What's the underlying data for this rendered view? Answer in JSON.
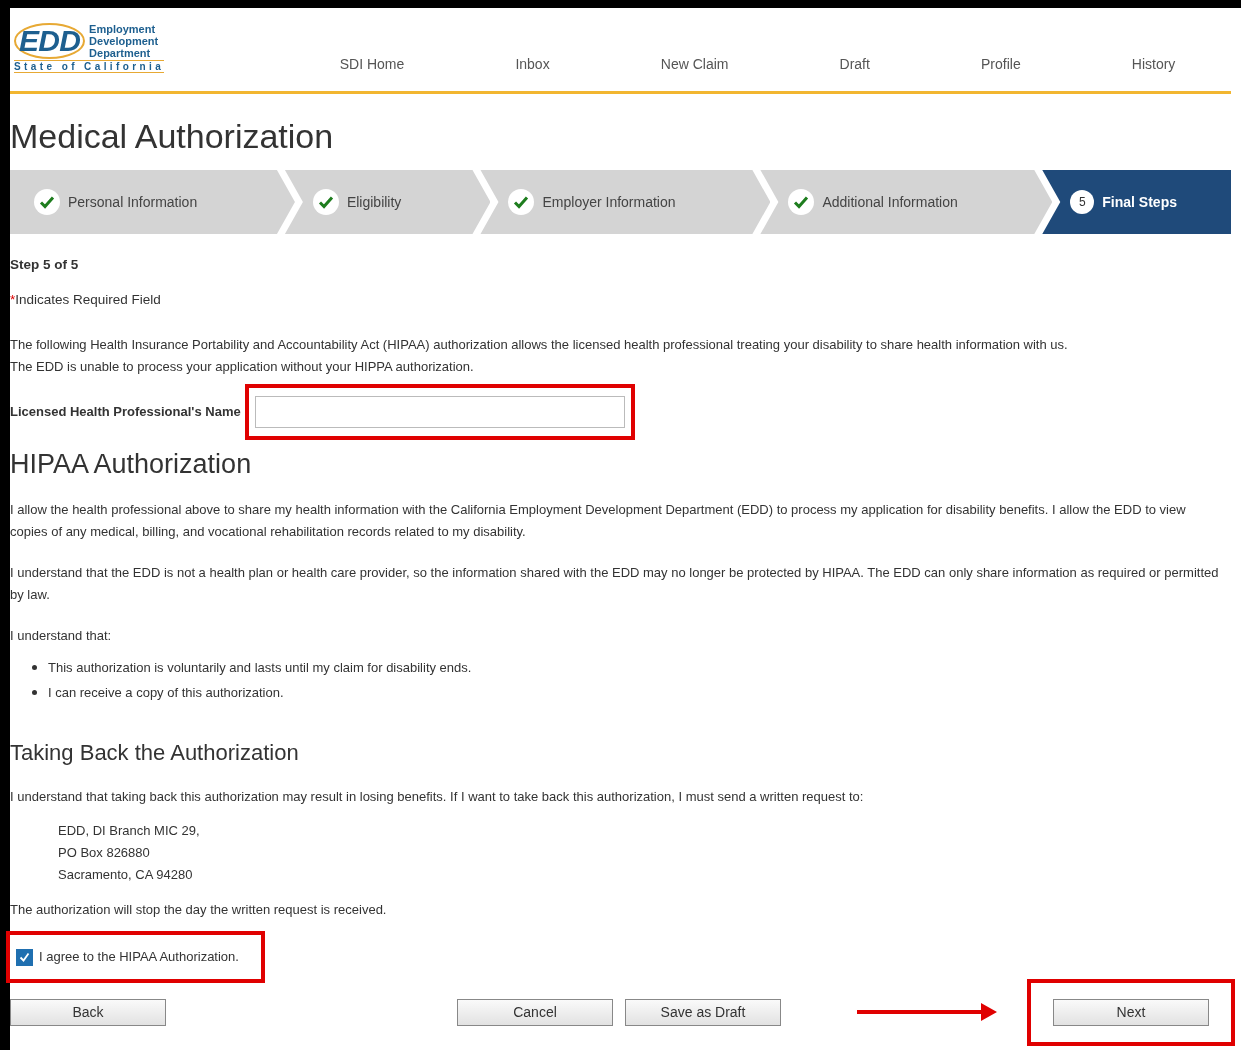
{
  "logo": {
    "acronym": "EDD",
    "name_lines": [
      "Employment",
      "Development",
      "Department"
    ],
    "state": "State of California"
  },
  "nav": [
    {
      "label": "SDI Home"
    },
    {
      "label": "Inbox"
    },
    {
      "label": "New Claim"
    },
    {
      "label": "Draft"
    },
    {
      "label": "Profile"
    },
    {
      "label": "History"
    }
  ],
  "page_title": "Medical Authorization",
  "steps": [
    {
      "label": "Personal Information",
      "kind": "complete"
    },
    {
      "label": "Eligibility",
      "kind": "complete"
    },
    {
      "label": "Employer Information",
      "kind": "complete"
    },
    {
      "label": "Additional Information",
      "kind": "complete"
    },
    {
      "label": "Final Steps",
      "kind": "current",
      "number": "5"
    }
  ],
  "step_indicator": "Step 5 of 5",
  "required_note": {
    "mark": "*",
    "text": "Indicates Required Field"
  },
  "intro": [
    "The following Health Insurance Portability and Accountability Act (HIPAA) authorization allows the licensed health professional treating your disability to share health information with us.",
    "The EDD is unable to process your application without your HIPPA authorization."
  ],
  "name_field": {
    "label": "Licensed Health Professional's Name",
    "highlighted": true
  },
  "hipaa_heading": "HIPAA Authorization",
  "hipaa_paragraphs": [
    "I allow the health professional above to share my health information with the California Employment Development Department (EDD) to process my application for disability benefits. I allow the EDD to view copies of any medical, billing, and vocational rehabilitation records related to my disability.",
    "I understand that the EDD is not a health plan or health care provider, so the information shared with the EDD may no longer be protected by HIPAA. The EDD can only share information as required or permitted by law.",
    "I understand that:"
  ],
  "bullets": [
    "This authorization is voluntarily and lasts until my claim for disability ends.",
    "I can receive a copy of this authorization."
  ],
  "taking_back_heading": "Taking Back the Authorization",
  "taking_back_text": "I understand that taking back this authorization may result in losing benefits. If I want to take back this authorization, I must send a written request to:",
  "address": [
    "EDD, DI Branch MIC 29,",
    "PO Box 826880",
    "Sacramento, CA 94280"
  ],
  "stop_note": "The authorization will stop the day the written request is received.",
  "agree": {
    "label": "I agree to the HIPAA Authorization.",
    "checked": true,
    "highlighted": true
  },
  "buttons": {
    "left": [
      {
        "label": "Back",
        "highlighted": false,
        "arrow": false
      }
    ],
    "center": [
      {
        "label": "Cancel",
        "highlighted": false,
        "arrow": false
      },
      {
        "label": "Save as Draft",
        "highlighted": false,
        "arrow": false
      }
    ],
    "right": [
      {
        "label": "Next",
        "highlighted": true,
        "arrow": true
      }
    ]
  }
}
